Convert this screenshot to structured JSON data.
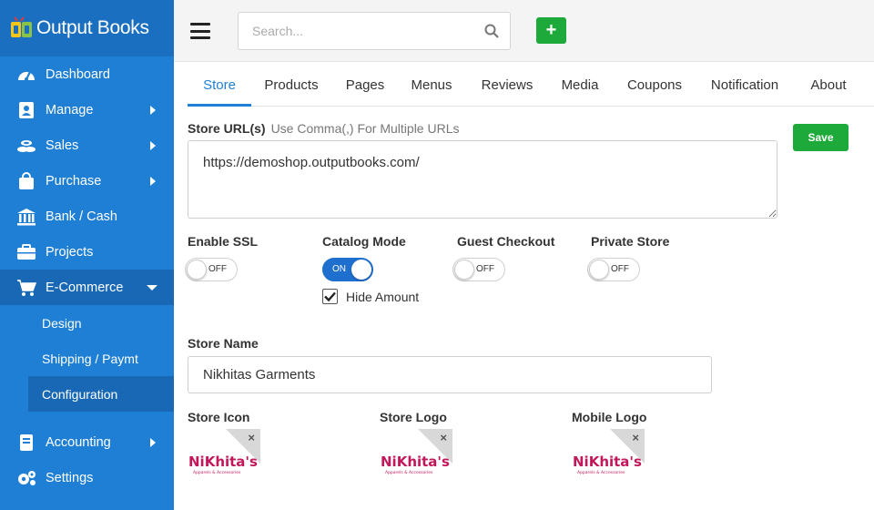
{
  "brand": {
    "name": "Output Books"
  },
  "sidebar": {
    "items": [
      {
        "label": "Dashboard",
        "icon": "dashboard-gauge-icon"
      },
      {
        "label": "Manage",
        "icon": "contact-book-icon"
      },
      {
        "label": "Sales",
        "icon": "coins-icon"
      },
      {
        "label": "Purchase",
        "icon": "shopping-bag-icon"
      },
      {
        "label": "Bank / Cash",
        "icon": "bank-icon"
      },
      {
        "label": "Projects",
        "icon": "briefcase-icon"
      },
      {
        "label": "E-Commerce",
        "icon": "cart-icon"
      },
      {
        "label": "Accounting",
        "icon": "ledger-book-icon"
      },
      {
        "label": "Settings",
        "icon": "gears-icon"
      }
    ],
    "ecommerce_sub": [
      {
        "label": "Design"
      },
      {
        "label": "Shipping / Paymt"
      },
      {
        "label": "Configuration"
      }
    ]
  },
  "header": {
    "search_placeholder": "Search...",
    "add_label": "+"
  },
  "tabs": [
    {
      "label": "Store"
    },
    {
      "label": "Products"
    },
    {
      "label": "Pages"
    },
    {
      "label": "Menus"
    },
    {
      "label": "Reviews"
    },
    {
      "label": "Media"
    },
    {
      "label": "Coupons"
    },
    {
      "label": "Notification"
    },
    {
      "label": "About"
    }
  ],
  "form": {
    "store_url_label": "Store URL(s)",
    "store_url_hint": "Use Comma(,) For Multiple URLs",
    "store_url_value": "https://demoshop.outputbooks.com/",
    "save_label": "Save",
    "toggles": {
      "enable_ssl": {
        "label": "Enable SSL",
        "state": "OFF"
      },
      "catalog_mode": {
        "label": "Catalog Mode",
        "state": "ON"
      },
      "guest_checkout": {
        "label": "Guest Checkout",
        "state": "OFF"
      },
      "private_store": {
        "label": "Private Store",
        "state": "OFF"
      }
    },
    "hide_amount_label": "Hide Amount",
    "store_name_label": "Store Name",
    "store_name_value": "Nikhitas Garments",
    "store_icon_label": "Store Icon",
    "store_logo_label": "Store Logo",
    "mobile_logo_label": "Mobile Logo",
    "logo_text": "NiKhita's",
    "logo_tagline": "Apparels & Accessories",
    "remove_icon": "×"
  },
  "colors": {
    "sidebar": "#1f7fd4",
    "accent": "#1f7fd4",
    "success": "#1eaa3a"
  }
}
